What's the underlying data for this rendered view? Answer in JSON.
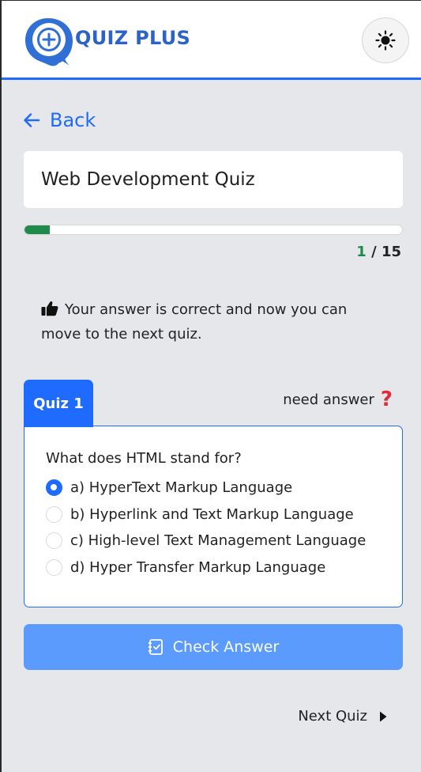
{
  "header": {
    "brand": "QUIZ PLUS",
    "logo_icon": "quiz-plus-logo-icon",
    "theme_icon": "sun-icon"
  },
  "nav": {
    "back_label": "Back",
    "back_icon": "arrow-left-icon"
  },
  "quiz": {
    "title": "Web Development Quiz",
    "progress": {
      "current": "1",
      "separator": "/",
      "total": "15",
      "fraction": 0.0667
    },
    "feedback": "Your answer is correct and now you can move to the next quiz.",
    "feedback_icon": "thumbs-up-icon",
    "tab_label": "Quiz 1",
    "need_answer_label": "need answer",
    "need_answer_icon": "question-mark-icon",
    "question": "What does HTML stand for?",
    "options": [
      {
        "label": "a) HyperText Markup Language",
        "selected": true
      },
      {
        "label": "b) Hyperlink and Text Markup Language",
        "selected": false
      },
      {
        "label": "c) High-level Text Management Language",
        "selected": false
      },
      {
        "label": "d) Hyper Transfer Markup Language",
        "selected": false
      }
    ],
    "check_answer_label": "Check Answer",
    "check_answer_icon": "checklist-icon",
    "next_label": "Next Quiz",
    "next_icon": "caret-right-icon"
  },
  "colors": {
    "accent": "#1f6bff",
    "success": "#1e8a4c",
    "danger": "#e02b3a",
    "button": "#5a9bfd",
    "background": "#e6e7ea"
  }
}
